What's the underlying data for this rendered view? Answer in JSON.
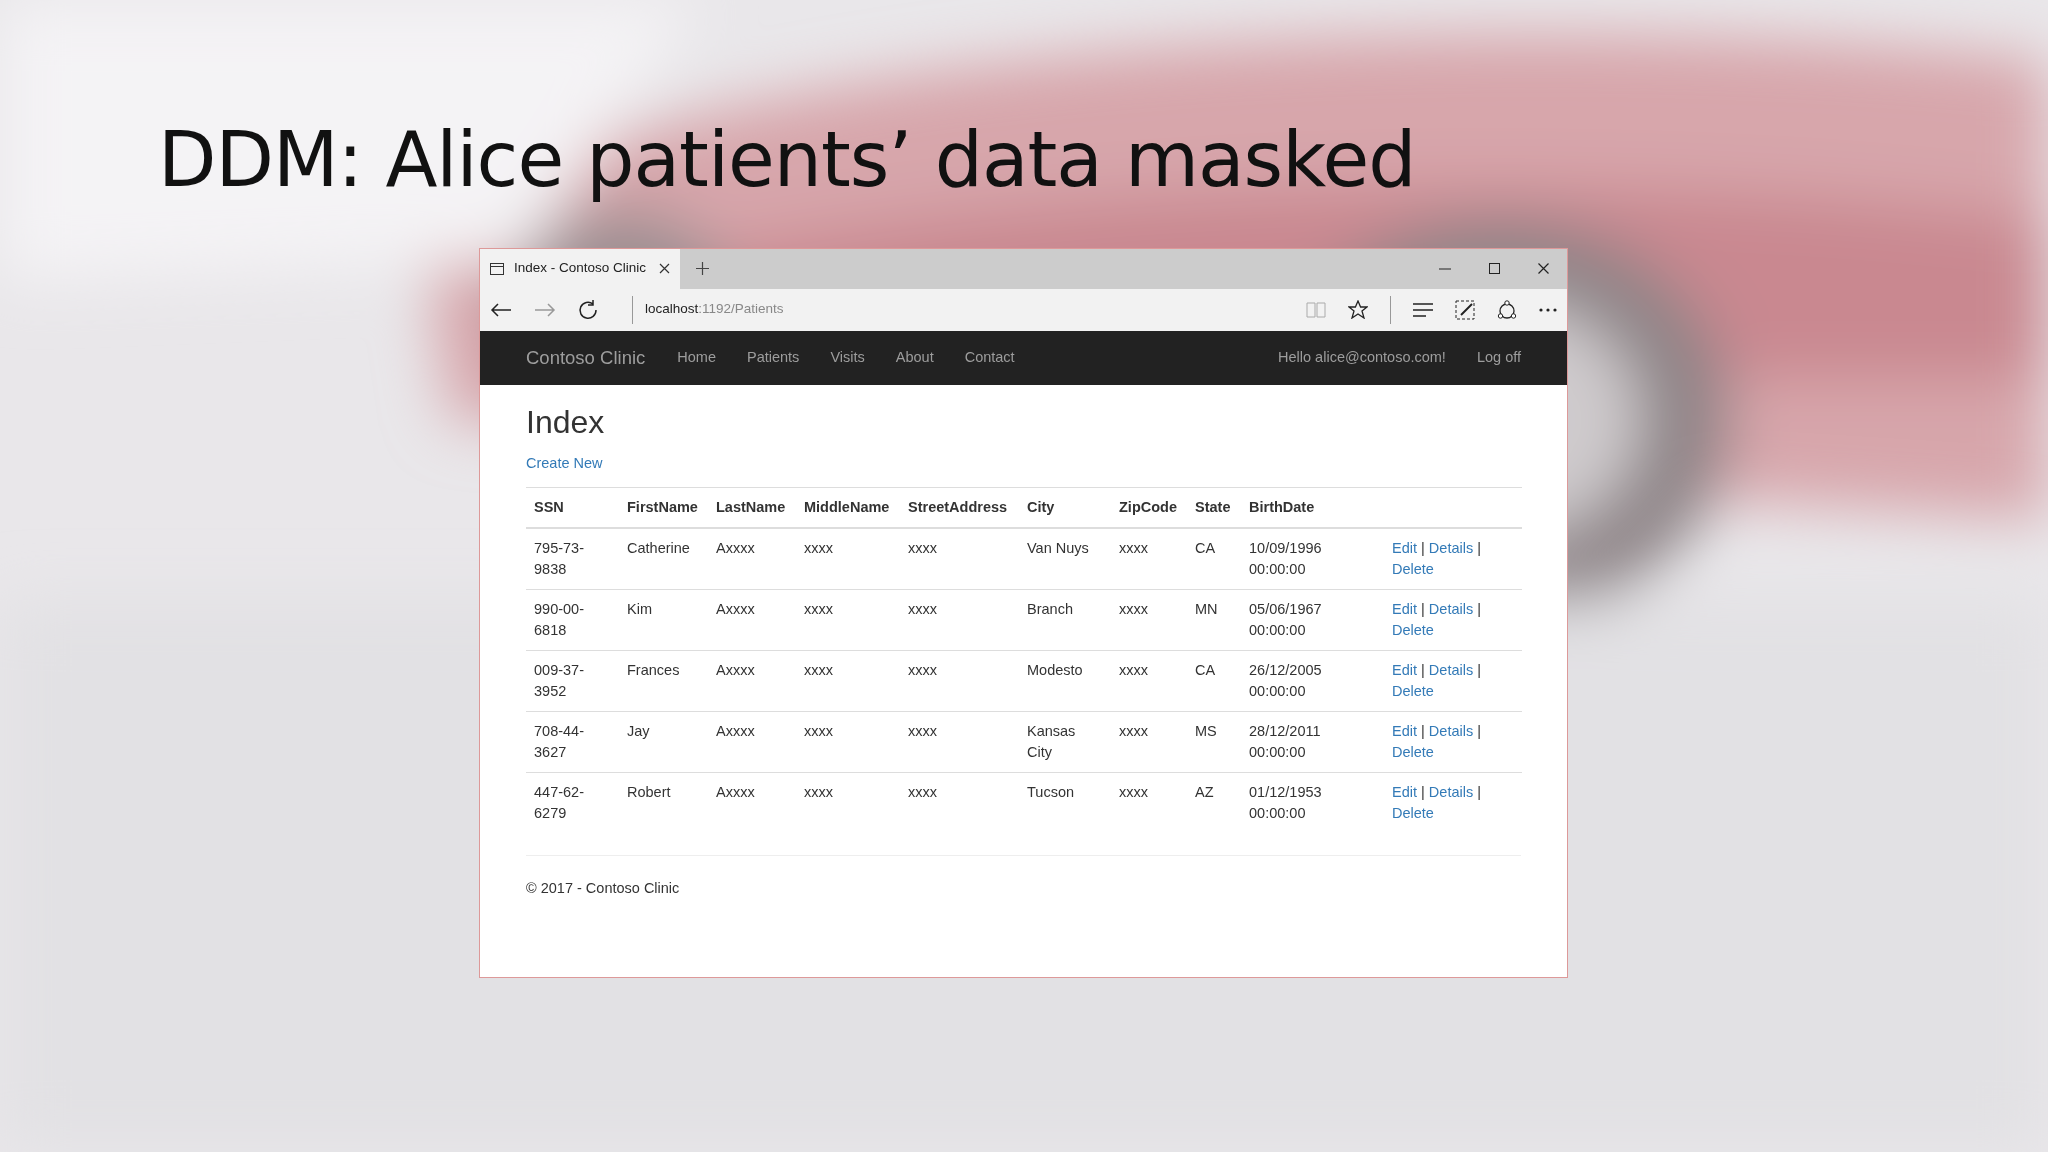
{
  "slide": {
    "title": "DDM: Alice patients’ data masked"
  },
  "browser": {
    "tab_title": "Index - Contoso Clinic",
    "url_host": "localhost",
    "url_path": ":1192/Patients"
  },
  "navbar": {
    "brand": "Contoso Clinic",
    "links": [
      "Home",
      "Patients",
      "Visits",
      "About",
      "Contact"
    ],
    "greeting": "Hello alice@contoso.com!",
    "logoff": "Log off"
  },
  "page": {
    "heading": "Index",
    "create_link": "Create New",
    "columns": [
      "SSN",
      "FirstName",
      "LastName",
      "MiddleName",
      "StreetAddress",
      "City",
      "ZipCode",
      "State",
      "BirthDate"
    ],
    "separator": "|",
    "rows": [
      {
        "cells": [
          "795-73-9838",
          "Catherine",
          "Axxxx",
          "xxxx",
          "xxxx",
          "Van Nuys",
          "xxxx",
          "CA",
          "10/09/1996 00:00:00"
        ],
        "actions": [
          "Edit",
          "Details",
          "Delete"
        ]
      },
      {
        "cells": [
          "990-00-6818",
          "Kim",
          "Axxxx",
          "xxxx",
          "xxxx",
          "Branch",
          "xxxx",
          "MN",
          "05/06/1967 00:00:00"
        ],
        "actions": [
          "Edit",
          "Details",
          "Delete"
        ]
      },
      {
        "cells": [
          "009-37-3952",
          "Frances",
          "Axxxx",
          "xxxx",
          "xxxx",
          "Modesto",
          "xxxx",
          "CA",
          "26/12/2005 00:00:00"
        ],
        "actions": [
          "Edit",
          "Details",
          "Delete"
        ]
      },
      {
        "cells": [
          "708-44-3627",
          "Jay",
          "Axxxx",
          "xxxx",
          "xxxx",
          "Kansas City",
          "xxxx",
          "MS",
          "28/12/2011 00:00:00"
        ],
        "actions": [
          "Edit",
          "Details",
          "Delete"
        ]
      },
      {
        "cells": [
          "447-62-6279",
          "Robert",
          "Axxxx",
          "xxxx",
          "xxxx",
          "Tucson",
          "xxxx",
          "AZ",
          "01/12/1953 00:00:00"
        ],
        "actions": [
          "Edit",
          "Details",
          "Delete"
        ]
      }
    ],
    "footer": "© 2017 - Contoso Clinic"
  }
}
